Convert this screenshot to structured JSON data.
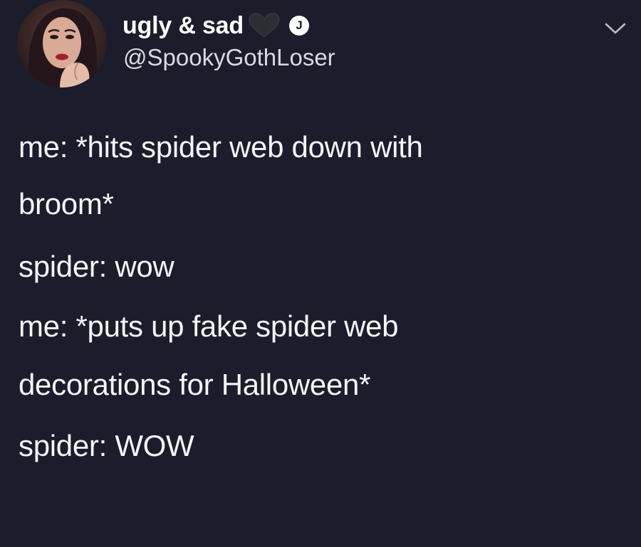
{
  "user": {
    "display_name": "ugly & sad",
    "handle": "@SpookyGothLoser",
    "badge_letter": "J",
    "name_emoji": "black-heart-icon"
  },
  "header": {
    "menu_icon": "chevron-down-icon"
  },
  "tweet": {
    "lines": [
      "me: *hits spider web down with",
      "broom*",
      "spider: wow",
      "me: *puts up fake spider web",
      "decorations for Halloween*",
      "spider: WOW"
    ]
  },
  "colors": {
    "background": "#1b1d2c",
    "text": "#f4f5f7"
  }
}
